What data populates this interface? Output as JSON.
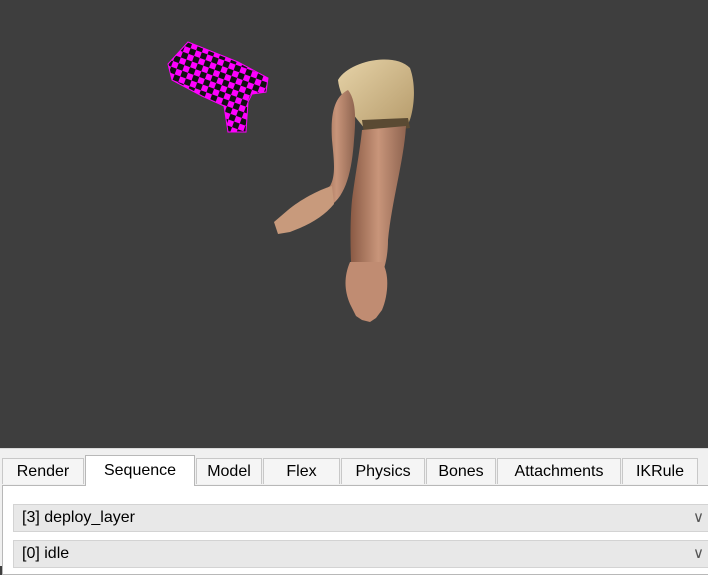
{
  "tabs": [
    {
      "label": "Render",
      "active": false
    },
    {
      "label": "Sequence",
      "active": true
    },
    {
      "label": "Model",
      "active": false
    },
    {
      "label": "Flex",
      "active": false
    },
    {
      "label": "Physics",
      "active": false
    },
    {
      "label": "Bones",
      "active": false
    },
    {
      "label": "Attachments",
      "active": false
    },
    {
      "label": "IKRule",
      "active": false
    }
  ],
  "sequence": {
    "layer_select": {
      "value": "[3] deploy_layer",
      "icon": "chevron-down-icon"
    },
    "sequence_select": {
      "value": "[0] idle",
      "icon": "chevron-down-icon"
    }
  },
  "viewport": {
    "background": "#3e3e3e",
    "missing_texture_colors": [
      "#ff00ff",
      "#000000"
    ],
    "skin_color": "#c89a7c",
    "sleeve_color": "#d8c49a"
  }
}
